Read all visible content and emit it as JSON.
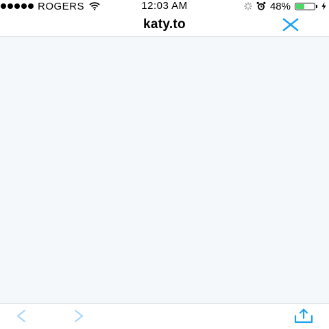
{
  "status_bar": {
    "carrier": "ROGERS",
    "time": "12:03 AM",
    "battery_percent": "48%",
    "battery_level": 0.48,
    "signal_bars": 5
  },
  "navbar": {
    "title": "katy.to",
    "close_icon": "close-icon"
  },
  "toolbar": {
    "back_icon": "chevron-left-icon",
    "forward_icon": "chevron-right-icon",
    "share_icon": "share-icon"
  },
  "colors": {
    "accent": "#1da1f2",
    "disabled_accent": "#a9d8f8",
    "webview_bg": "#f4f8fb",
    "battery_green": "#4cd964"
  }
}
